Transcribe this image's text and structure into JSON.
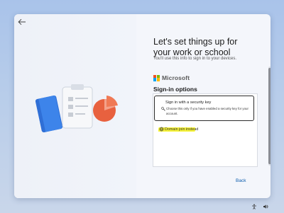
{
  "window": {
    "title": "Let's set things up for your work or school",
    "subtitle": "You'll use this info to sign in to your devices."
  },
  "brand": {
    "name": "Microsoft"
  },
  "signin": {
    "header": "Sign-in options",
    "options": [
      {
        "title": "Sign in with a security key",
        "description": "Choose this only if you have enabled a security key for your account."
      },
      {
        "title": "Domain join instead"
      }
    ]
  },
  "footer": {
    "back_label": "Back"
  },
  "colors": {
    "accent": "#0b5cad",
    "highlight": "#f6f22c",
    "ms_red": "#f25022",
    "ms_green": "#7fba00",
    "ms_blue": "#00a4ef",
    "ms_yellow": "#ffb900"
  },
  "icons": [
    "back-arrow-icon",
    "security-key-icon",
    "domain-join-icon",
    "accessibility-icon",
    "volume-icon"
  ]
}
